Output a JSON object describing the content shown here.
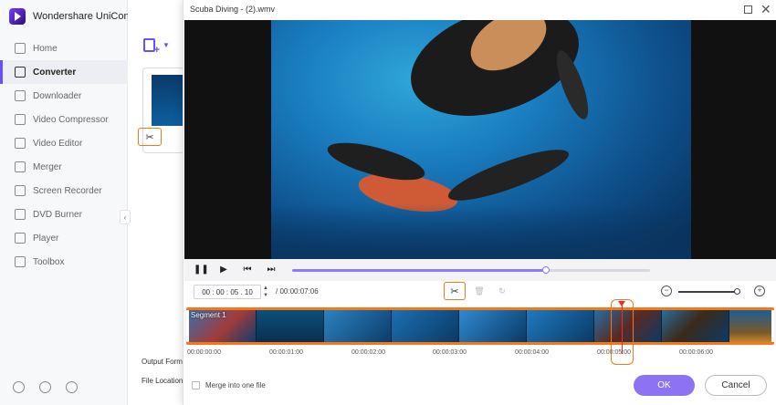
{
  "app": {
    "name": "Wondershare UniConverter",
    "nav": [
      {
        "label": "Home",
        "icon": "home-icon"
      },
      {
        "label": "Converter",
        "icon": "converter-icon",
        "active": true
      },
      {
        "label": "Downloader",
        "icon": "downloader-icon"
      },
      {
        "label": "Video Compressor",
        "icon": "compressor-icon"
      },
      {
        "label": "Video Editor",
        "icon": "editor-icon"
      },
      {
        "label": "Merger",
        "icon": "merger-icon"
      },
      {
        "label": "Screen Recorder",
        "icon": "recorder-icon"
      },
      {
        "label": "DVD Burner",
        "icon": "dvd-icon"
      },
      {
        "label": "Player",
        "icon": "player-icon"
      },
      {
        "label": "Toolbox",
        "icon": "toolbox-icon"
      }
    ],
    "footer_icons": [
      "help-icon",
      "bell-icon",
      "feedback-icon"
    ],
    "accent": "#6c4dff"
  },
  "main": {
    "output_format_label": "Output Form",
    "file_location_label": "File Location:"
  },
  "dialog": {
    "title": "Scuba Diving - (2).wmv",
    "current_time": "00 : 00 : 05 . 10",
    "duration": "/ 00:00:07:06",
    "progress_fraction": 0.71,
    "zoom_fraction": 0.94,
    "segment_label": "Segment 1",
    "ruler_ticks": [
      "00:00:00:00",
      "00:00:01:00",
      "00:00:02:00",
      "00:00:03:00",
      "00:00:04:00",
      "00:00:05:00",
      "00:00:06:00"
    ],
    "playhead_time": "00:00:05:00",
    "merge_label": "Merge into one file",
    "ok_label": "OK",
    "cancel_label": "Cancel",
    "highlight_color": "#f07a1a",
    "ok_color": "#8d73f4"
  }
}
